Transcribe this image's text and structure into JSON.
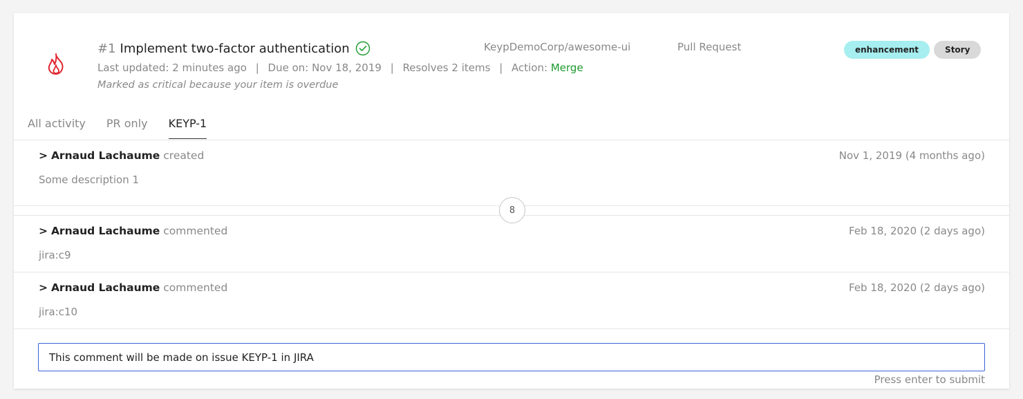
{
  "item": {
    "number": "#1",
    "title": "Implement two-factor authentication",
    "repo": "KeypDemoCorp/awesome-ui",
    "type": "Pull Request",
    "tags": [
      "enhancement",
      "Story"
    ],
    "meta": {
      "last_updated": "Last updated: 2 minutes ago",
      "due": "Due on: Nov 18, 2019",
      "resolves": "Resolves 2 items",
      "action_label": "Action:",
      "action_value": "Merge",
      "separator": "|"
    },
    "critical_note": "Marked as critical because your item is overdue"
  },
  "tabs": [
    "All activity",
    "PR only",
    "KEYP-1"
  ],
  "active_tab": "KEYP-1",
  "activity": [
    {
      "prefix": ">",
      "author": "Arnaud Lachaume",
      "verb": "created",
      "date": "Nov 1, 2019 (4 months ago)",
      "body": "Some description 1"
    },
    {
      "prefix": ">",
      "author": "Arnaud Lachaume",
      "verb": "commented",
      "date": "Feb 18, 2020 (2 days ago)",
      "body": "jira:c9"
    },
    {
      "prefix": ">",
      "author": "Arnaud Lachaume",
      "verb": "commented",
      "date": "Feb 18, 2020 (2 days ago)",
      "body": "jira:c10"
    }
  ],
  "hidden_count": "8",
  "comment": {
    "value": "This comment will be made on issue KEYP-1 in JIRA",
    "hint": "Press enter to submit"
  },
  "colors": {
    "flame": "#e0262f",
    "check": "#1d9a2e",
    "action": "#1d9a2e",
    "tag_enhancement": "#a6eef0",
    "tag_story": "#d9d9d9",
    "input_border": "#3a63d8"
  },
  "icons": {
    "priority": "flame-icon",
    "status": "check-circle-icon"
  }
}
